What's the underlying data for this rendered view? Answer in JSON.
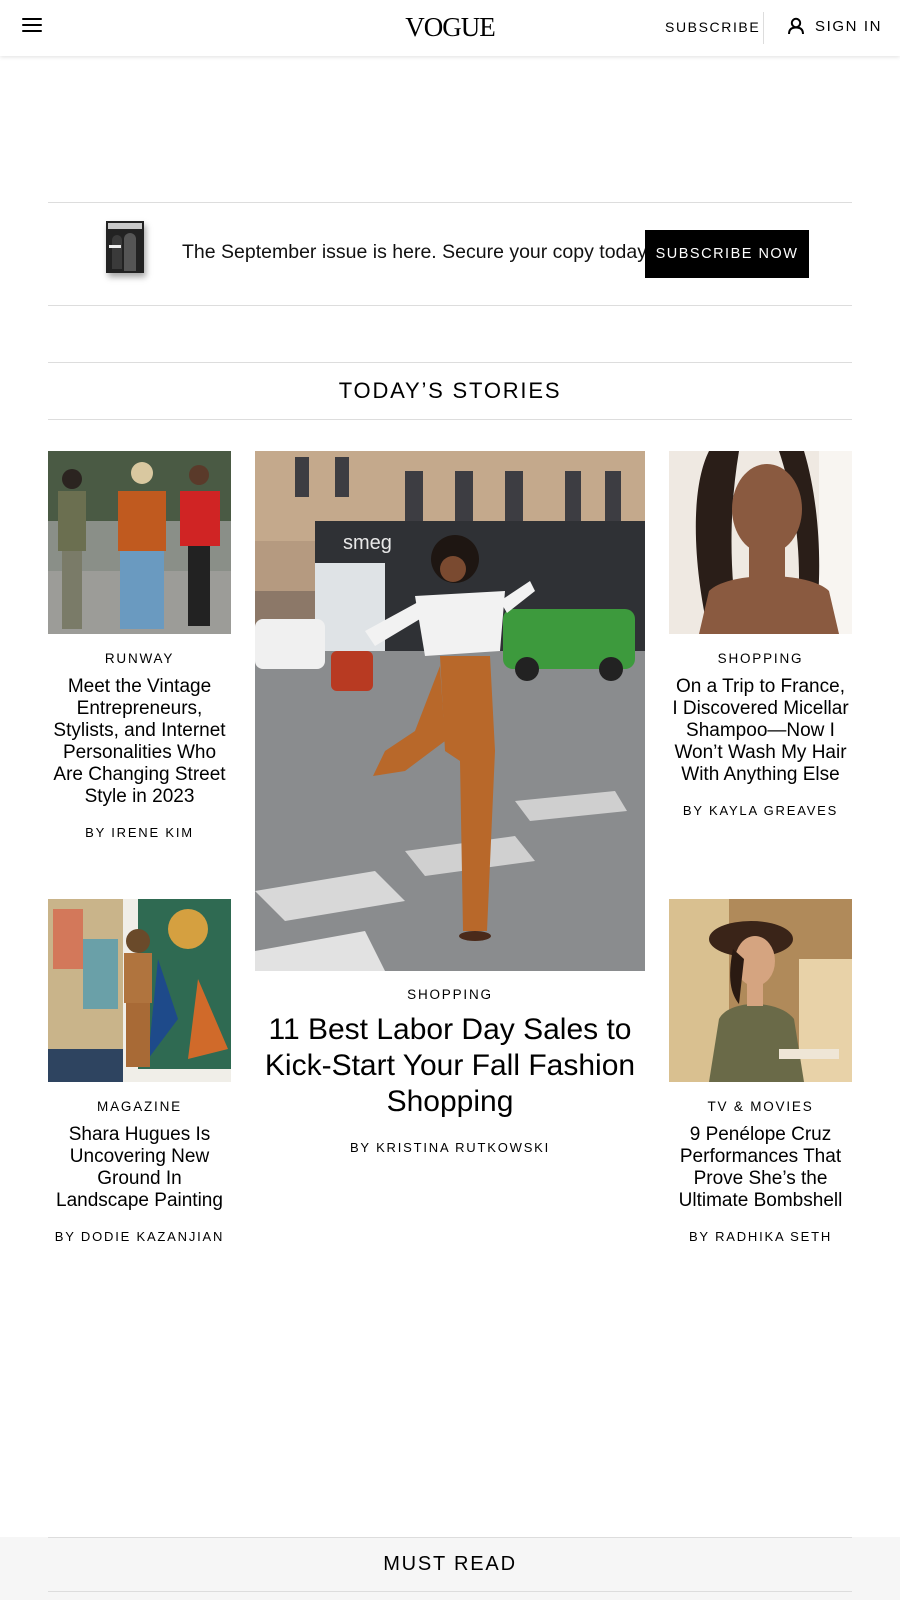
{
  "header": {
    "logo": "VOGUE",
    "subscribe_label": "SUBSCRIBE",
    "signin_label": "SIGN IN"
  },
  "promo": {
    "text": "The September issue is here. Secure your copy today.",
    "button_label": "SUBSCRIBE NOW"
  },
  "sections": {
    "todays_stories": "TODAY’S STORIES",
    "must_read": "MUST READ"
  },
  "stories": [
    {
      "category": "RUNWAY",
      "headline": "Meet the Vintage Entrepreneurs, Stylists, and Internet Personalities Who Are Changing Street Style in 2023",
      "byline": "BY IRENE KIM"
    },
    {
      "category": "SHOPPING",
      "headline": "11 Best Labor Day Sales to Kick-Start Your Fall Fashion Shopping",
      "byline": "BY KRISTINA RUTKOWSKI"
    },
    {
      "category": "SHOPPING",
      "headline": "On a Trip to France, I Discovered Micellar Shampoo—Now I Won’t Wash My Hair With Anything Else",
      "byline": "BY KAYLA GREAVES"
    },
    {
      "category": "MAGAZINE",
      "headline": "Shara Hugues Is Uncovering New Ground In Landscape Painting",
      "byline": "BY DODIE KAZANJIAN"
    },
    {
      "category": "TV & MOVIES",
      "headline": "9 Penélope Cruz Performances That Prove She’s the Ultimate Bombshell",
      "byline": "BY RADHIKA SETH"
    }
  ],
  "image_text": {
    "storefront_sign": "smeg"
  }
}
